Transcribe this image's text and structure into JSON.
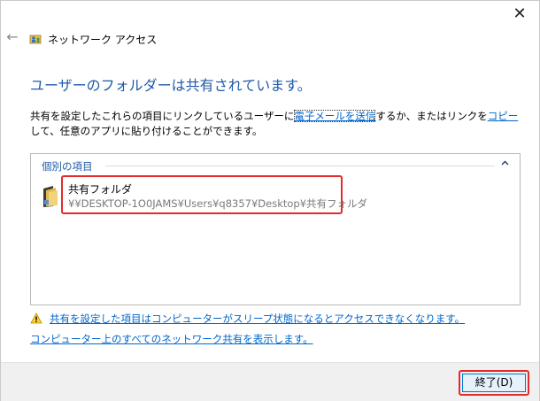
{
  "window": {
    "title": "ネットワーク アクセス",
    "close_glyph": "✕",
    "back_glyph": "←"
  },
  "main": {
    "heading": "ユーザーのフォルダーは共有されています。",
    "desc_part1": "共有を設定したこれらの項目にリンクしているユーザーに",
    "email_link": "電子メールを送信",
    "desc_part2": "するか、またはリンクを",
    "copy_link": "コピー",
    "desc_part3": "して、任意のアプリに貼り付けることができます。"
  },
  "list": {
    "group_label": "個別の項目",
    "items": [
      {
        "name": "共有フォルダ",
        "path": "¥¥DESKTOP-1O0JAMS¥Users¥q8357¥Desktop¥共有フォルダ"
      }
    ]
  },
  "links": {
    "warning": "共有を設定した項目はコンピューターがスリープ状態になるとアクセスできなくなります。",
    "show_all": "コンピューター上のすべてのネットワーク共有を表示します。"
  },
  "footer": {
    "finish_label": "終了(D)"
  },
  "colors": {
    "heading": "#1f5aa8",
    "link": "#0066cc",
    "highlight": "#e32b2b"
  }
}
